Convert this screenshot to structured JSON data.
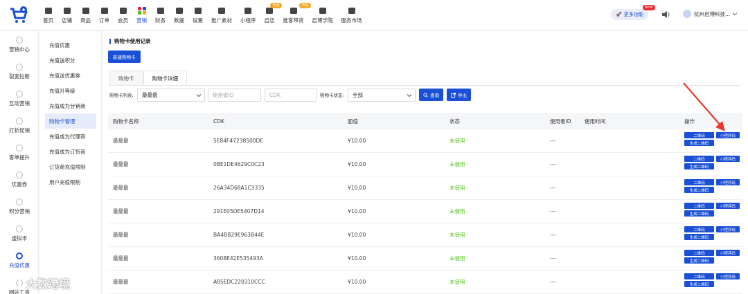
{
  "topnav": [
    {
      "label": "首页",
      "icon": "home-icon"
    },
    {
      "label": "店铺",
      "icon": "store-icon"
    },
    {
      "label": "商品",
      "icon": "goods-icon"
    },
    {
      "label": "订单",
      "icon": "order-icon"
    },
    {
      "label": "会员",
      "icon": "member-icon"
    },
    {
      "label": "营销",
      "icon": "marketing-icon",
      "active": true
    },
    {
      "label": "财务",
      "icon": "finance-icon"
    },
    {
      "label": "数据",
      "icon": "data-icon"
    },
    {
      "label": "设置",
      "icon": "settings-icon"
    },
    {
      "label": "推广素材",
      "icon": "share-icon"
    },
    {
      "label": "小程序",
      "icon": "miniprogram-icon"
    },
    {
      "label": "启店",
      "icon": "shop-open-icon",
      "badge": "升级"
    },
    {
      "label": "推客带货",
      "icon": "promoter-icon",
      "badge": "升级"
    },
    {
      "label": "启博学院",
      "icon": "academy-icon"
    },
    {
      "label": "服务市场",
      "icon": "market-icon"
    }
  ],
  "header": {
    "more_label": "更多功能",
    "new_badge": "NEW",
    "account": "杭州启博科技..."
  },
  "sidebar": [
    {
      "label": "营销中心"
    },
    {
      "label": "裂变拉新"
    },
    {
      "label": "互动营销"
    },
    {
      "label": "打折促销"
    },
    {
      "label": "客单提升"
    },
    {
      "label": "优惠券"
    },
    {
      "label": "积分营销"
    },
    {
      "label": "虚拟币"
    },
    {
      "label": "充值优惠",
      "active": true
    },
    {
      "label": "网站工具"
    }
  ],
  "subnav": [
    {
      "label": "充值优惠"
    },
    {
      "label": "充值送积分"
    },
    {
      "label": "充值送优惠券"
    },
    {
      "label": "充值升等级"
    },
    {
      "label": "充值成为分销商"
    },
    {
      "label": "购物卡管理",
      "active": true
    },
    {
      "label": "充值成为代理商"
    },
    {
      "label": "充值成为订货商"
    },
    {
      "label": "订货商充值限制"
    },
    {
      "label": "用户充值限制"
    }
  ],
  "page": {
    "title": "购物卡使用记录",
    "new_button": "新建购物卡",
    "tabs": [
      {
        "label": "购物卡"
      },
      {
        "label": "购物卡详细",
        "active": true
      }
    ]
  },
  "filters": {
    "card_list_label": "购物卡列表:",
    "card_list_value": "最最最",
    "user_id_placeholder": "使用者ID",
    "cdk_placeholder": "CDK",
    "status_label": "购物卡状态:",
    "status_value": "全部",
    "search_button": "查询",
    "export_button": "导出"
  },
  "table": {
    "headers": [
      "购物卡名称",
      "CDK",
      "面值",
      "状态",
      "使用者ID",
      "使用时间",
      "操作"
    ],
    "ops": {
      "qrcode": "二维码",
      "mini_qrcode": "小程序码",
      "generate": "生成二维码"
    },
    "rows": [
      {
        "name": "最最最",
        "cdk": "5E84F47238500DE",
        "value": "¥10.00",
        "status": "未使用",
        "user": "---"
      },
      {
        "name": "最最最",
        "cdk": "0BE1DE4629C0C23",
        "value": "¥10.00",
        "status": "未使用",
        "user": "---"
      },
      {
        "name": "最最最",
        "cdk": "26A34D68A1C3335",
        "value": "¥10.00",
        "status": "未使用",
        "user": "---"
      },
      {
        "name": "最最最",
        "cdk": "291E05DE5407D14",
        "value": "¥10.00",
        "status": "未使用",
        "user": "---"
      },
      {
        "name": "最最最",
        "cdk": "BA4BB29E963B44E",
        "value": "¥10.00",
        "status": "未使用",
        "user": "---"
      },
      {
        "name": "最最最",
        "cdk": "3608E42E535493A",
        "value": "¥10.00",
        "status": "未使用",
        "user": "---"
      },
      {
        "name": "最最最",
        "cdk": "A85EDC220310CCC",
        "value": "¥10.00",
        "status": "未使用",
        "user": "---"
      }
    ]
  },
  "watermark": "大数跨境",
  "colors": {
    "primary": "#1a4fd6",
    "success": "#52c41a",
    "annotation": "#e8382d"
  }
}
